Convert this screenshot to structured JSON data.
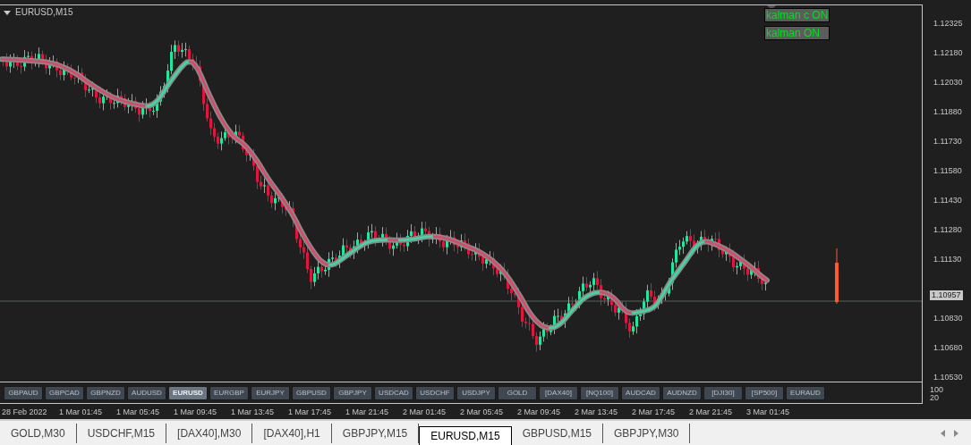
{
  "chart": {
    "title": "EURUSD,M15",
    "indicator_labels": [
      "kalman c ON",
      "kalman ON"
    ],
    "price_labels": [
      "1.12325",
      "1.12180",
      "1.12030",
      "1.11880",
      "1.11730",
      "1.11580",
      "1.11430",
      "1.11280",
      "1.11130",
      "1.10830",
      "1.10680",
      "1.10530"
    ],
    "current_price": "1.10957",
    "symbol_buttons": [
      {
        "label": "GBPAUD",
        "selected": false
      },
      {
        "label": "GBPCAD",
        "selected": false
      },
      {
        "label": "GBPNZD",
        "selected": false
      },
      {
        "label": "AUDUSD",
        "selected": false
      },
      {
        "label": "EURUSD",
        "selected": true
      },
      {
        "label": "EURGBP",
        "selected": false
      },
      {
        "label": "EURJPY",
        "selected": false
      },
      {
        "label": "GBPUSD",
        "selected": false
      },
      {
        "label": "GBPJPY",
        "selected": false
      },
      {
        "label": "USDCAD",
        "selected": false
      },
      {
        "label": "USDCHF",
        "selected": false
      },
      {
        "label": "USDJPY",
        "selected": false
      },
      {
        "label": "GOLD",
        "selected": false
      },
      {
        "label": "[DAX40]",
        "selected": false
      },
      {
        "label": "[NQ100]",
        "selected": false
      },
      {
        "label": "AUDCAD",
        "selected": false
      },
      {
        "label": "AUDNZD",
        "selected": false
      },
      {
        "label": "[DJI30]",
        "selected": false
      },
      {
        "label": "[SP500]",
        "selected": false
      },
      {
        "label": "EURAUD",
        "selected": false
      }
    ],
    "subwindow_scale": [
      "100",
      "20"
    ],
    "time_labels": [
      "28 Feb 2022",
      "1 Mar 01:45",
      "1 Mar 05:45",
      "1 Mar 09:45",
      "1 Mar 13:45",
      "1 Mar 17:45",
      "1 Mar 21:45",
      "2 Mar 01:45",
      "2 Mar 05:45",
      "2 Mar 09:45",
      "2 Mar 13:45",
      "2 Mar 17:45",
      "2 Mar 21:45",
      "3 Mar 01:45"
    ]
  },
  "tabs": [
    {
      "label": "GOLD,M30",
      "selected": false
    },
    {
      "label": "USDCHF,M15",
      "selected": false
    },
    {
      "label": "[DAX40],M30",
      "selected": false
    },
    {
      "label": "[DAX40],H1",
      "selected": false
    },
    {
      "label": "GBPJPY,M15",
      "selected": false
    },
    {
      "label": "EURUSD,M15",
      "selected": true
    },
    {
      "label": "GBPUSD,M15",
      "selected": false
    },
    {
      "label": "GBPJPY,M30",
      "selected": false
    }
  ]
}
